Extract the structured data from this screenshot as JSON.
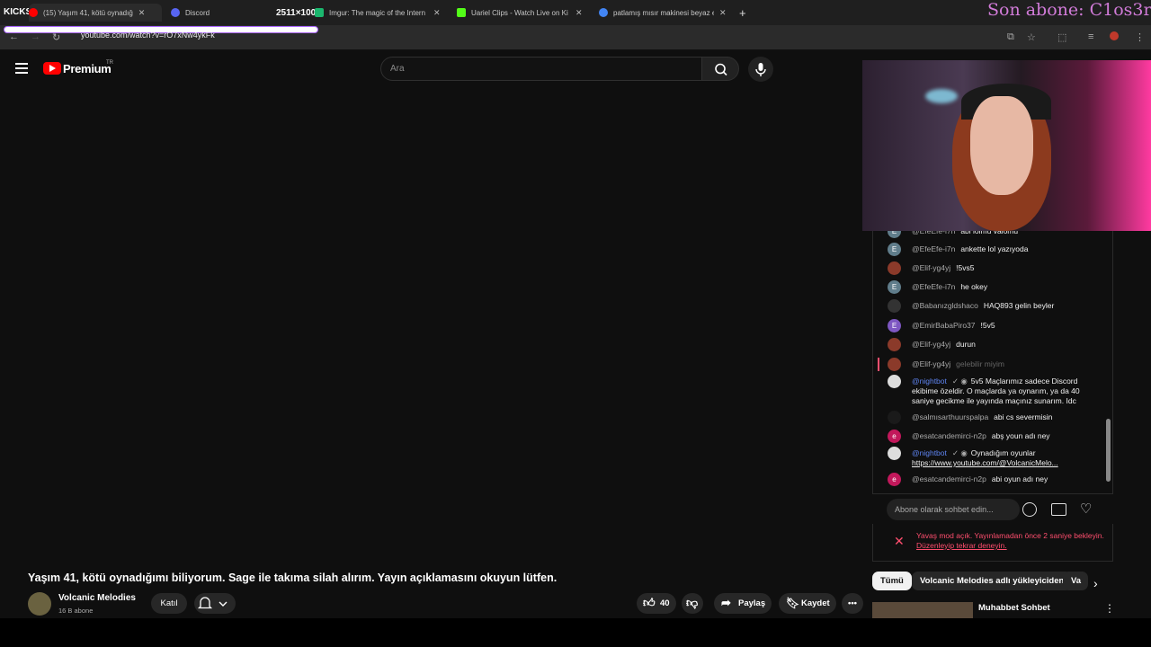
{
  "browser": {
    "kicks_label": "KICKS",
    "size_readout": "2511×1000",
    "stream_overlay": "Son abone: C1os3r",
    "tabs": [
      {
        "title": "(15) Yaşım 41, kötü oynadığ"
      },
      {
        "title": "Discord"
      },
      {
        "title": "Imgur: The magic of the Intern"
      },
      {
        "title": "Uariel Clips - Watch Live on Ki"
      },
      {
        "title": "patlamış mısır makinesi beyaz e"
      }
    ],
    "url": "youtube.com/watch?v=rO7xNw4ykFk"
  },
  "header": {
    "brand": "Premium",
    "region": "TR",
    "search_placeholder": "Ara"
  },
  "chat": {
    "messages": [
      {
        "author": "@EfeEfe-i7n",
        "text": "abi lolmu valomu",
        "avatar": "E",
        "color": "#607d8b"
      },
      {
        "author": "@EfeEfe-i7n",
        "text": "ankette lol yazıyoda",
        "avatar": "E",
        "color": "#607d8b"
      },
      {
        "author": "@Elif-yg4yj",
        "text": "!5vs5",
        "avatar": "",
        "color": "#8b3a2a"
      },
      {
        "author": "@EfeEfe-i7n",
        "text": "he okey",
        "avatar": "E",
        "color": "#607d8b"
      },
      {
        "author": "@Babanızgldshaco",
        "text": "HAQ893 gelin beyler",
        "avatar": "",
        "color": "#333"
      },
      {
        "author": "@EmirBabaPiro37",
        "text": "!5v5",
        "avatar": "E",
        "color": "#7e57c2"
      },
      {
        "author": "@Elif-yg4yj",
        "text": "durun",
        "avatar": "",
        "color": "#8b3a2a"
      },
      {
        "author": "@Elif-yg4yj",
        "text": "gelebilir miyim",
        "avatar": "",
        "color": "#8b3a2a",
        "deleted": true
      },
      {
        "author": "@nightbot",
        "text": "5v5 Maçlarımız sadece Discord ekibime özeldir. O maçlarda ya oynarım, ya da 40 saniye gecikme ile yayında maçınız sunarım. Idc",
        "avatar": "",
        "color": "#ddd",
        "moderator": true
      },
      {
        "author": "@salmısarthuurspalpa",
        "text": "abi cs severmisin",
        "avatar": "",
        "color": "#1a1a1a"
      },
      {
        "author": "@esatcandemirci-n2p",
        "text": "abş youn adı ney",
        "avatar": "e",
        "color": "#c2185b"
      },
      {
        "author": "@nightbot",
        "text": "Oynadığım oyunlar",
        "link": "https://www.youtube.com/@VolcanicMelo...",
        "avatar": "",
        "color": "#ddd",
        "moderator": true
      },
      {
        "author": "@esatcandemirci-n2p",
        "text": "abi oyun adı ney",
        "avatar": "e",
        "color": "#c2185b"
      }
    ],
    "input_placeholder": "Abone olarak sohbet edin...",
    "slow_mode_text": "Yavaş mod açık. Yayınlamadan önce 2 saniye bekleyin.",
    "slow_mode_link": "Düzenleyip tekrar deneyin."
  },
  "video": {
    "title": "Yaşım 41, kötü oynadığımı biliyorum. Sage ile takıma silah alırım. Yayın açıklamasını okuyun lütfen.",
    "channel": "Volcanic Melodies",
    "subscribers": "16 B abone",
    "join_label": "Katıl",
    "likes": "40",
    "share_label": "Paylaş",
    "save_label": "Kaydet"
  },
  "recommendations": {
    "chips": [
      "Tümü",
      "Volcanic Melodies adlı yükleyiciden",
      "Va"
    ],
    "first_title": "Muhabbet Sohbet"
  }
}
